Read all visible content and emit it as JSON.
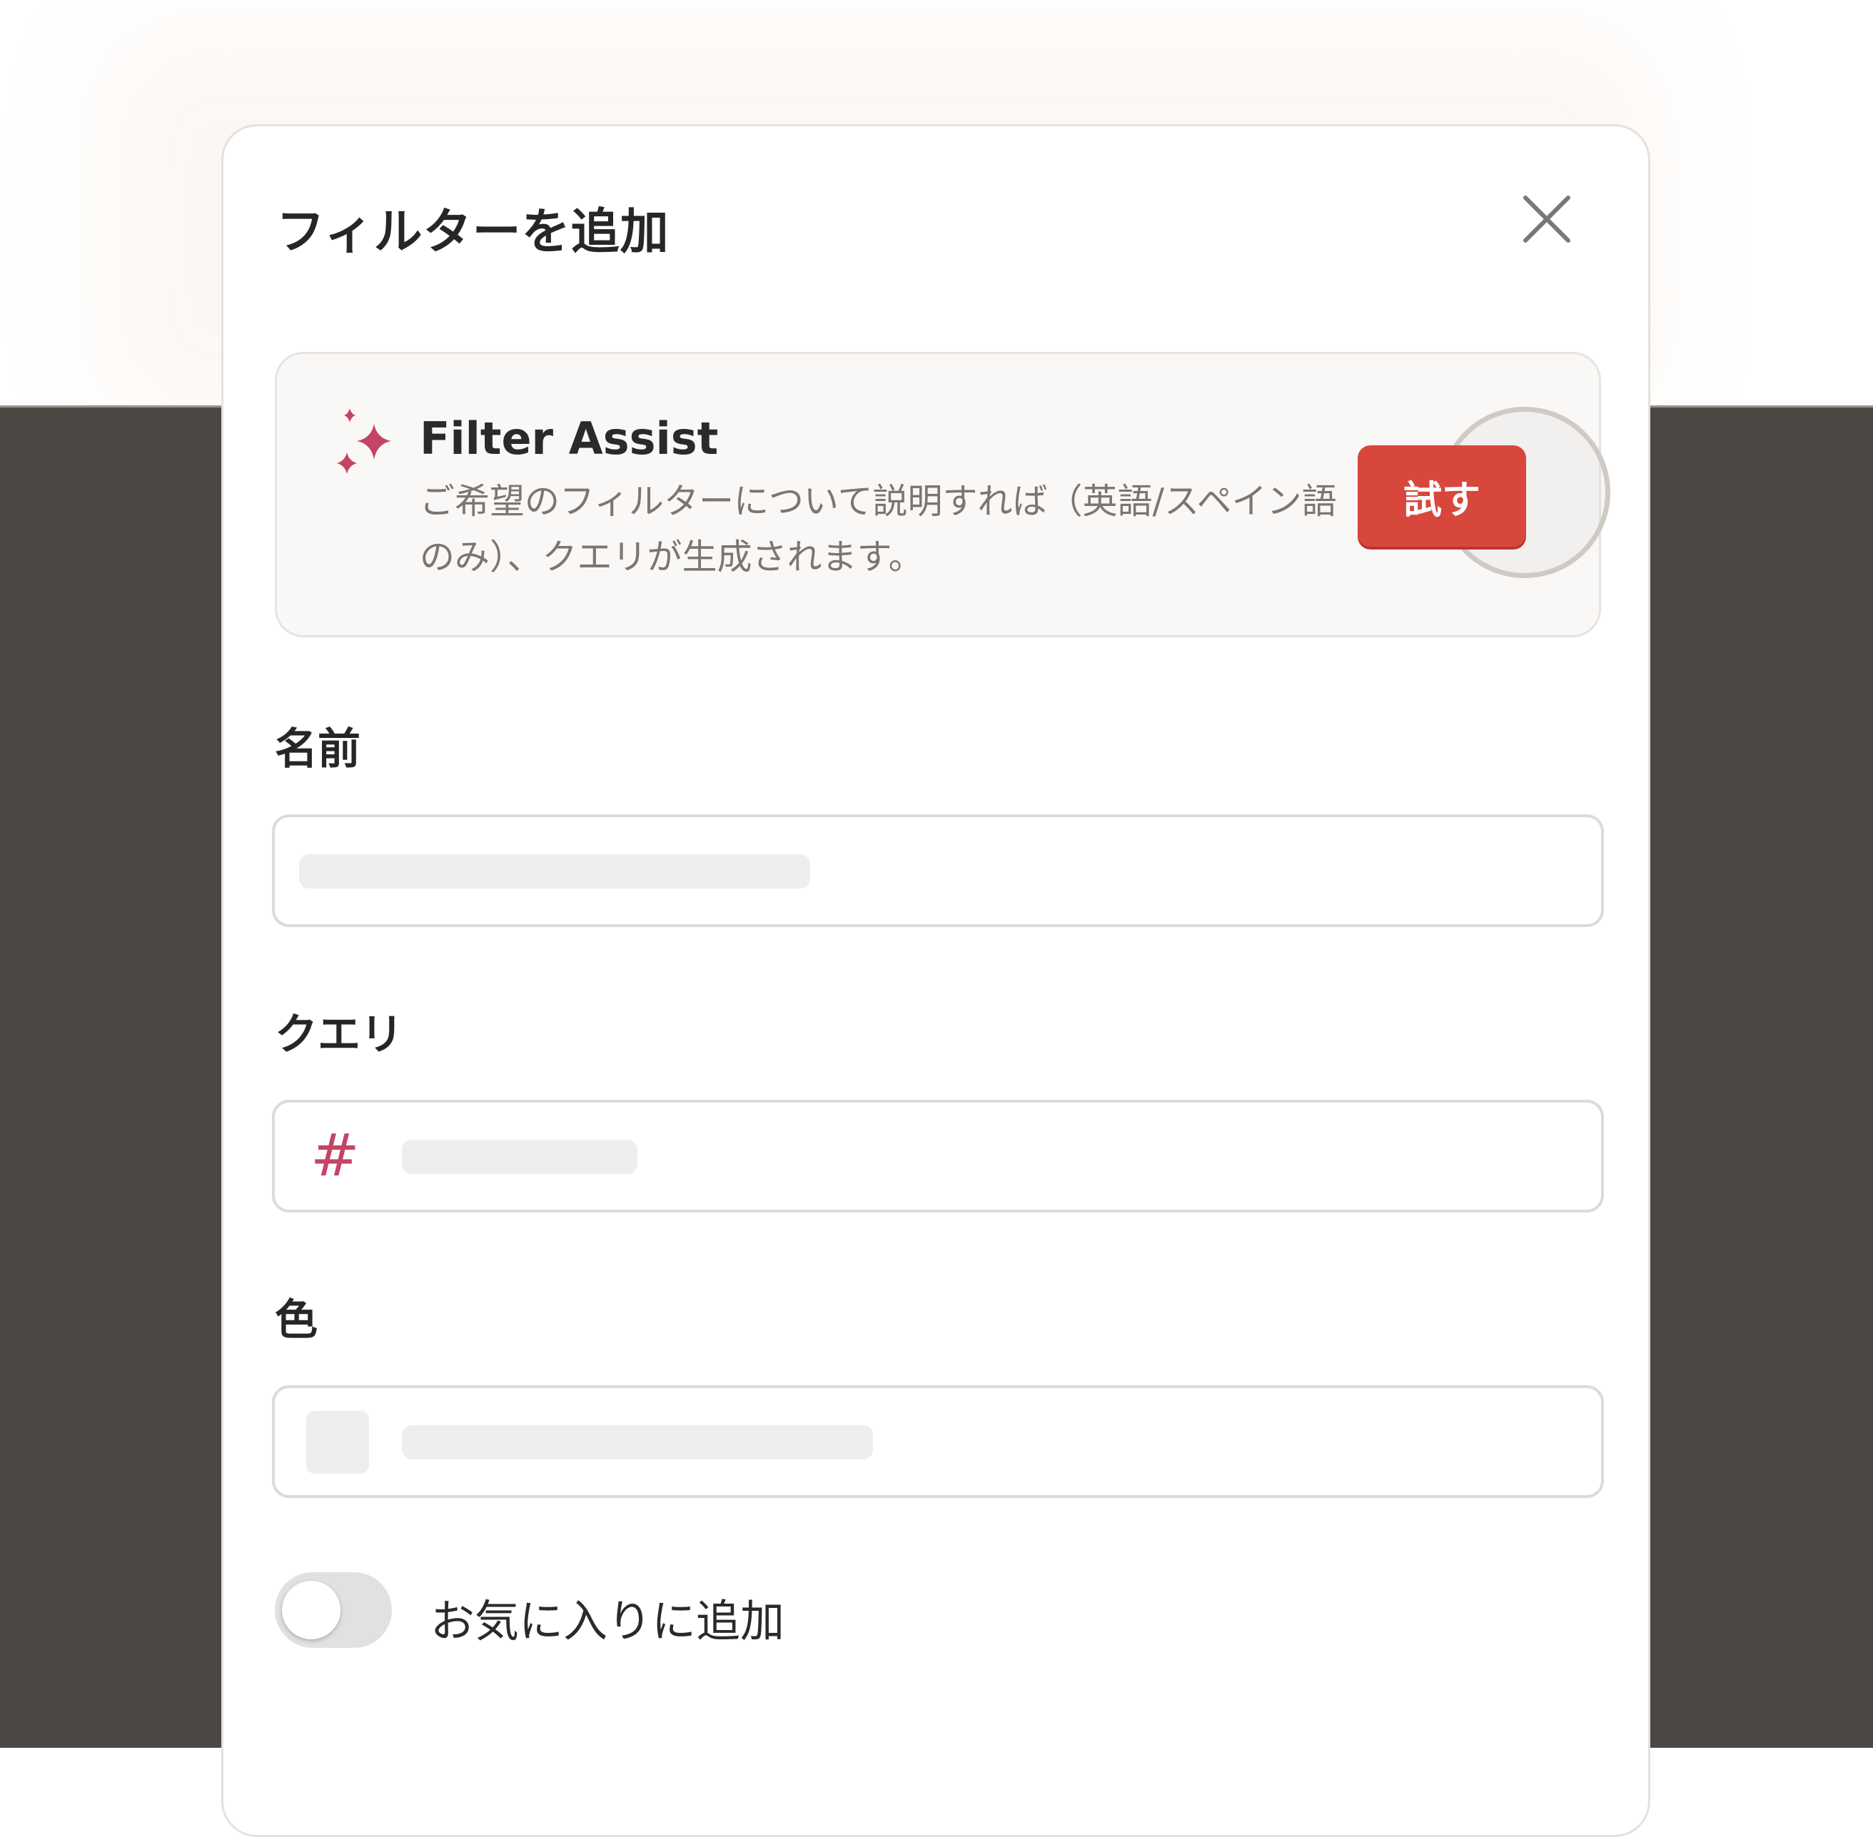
{
  "modal": {
    "title": "フィルターを追加",
    "close_icon": "close-icon"
  },
  "filter_assist": {
    "icon": "sparkle-icon",
    "title": "Filter Assist",
    "description": "ご希望のフィルターについて説明すれば（英語/スペイン語のみ）、クエリが生成されます。",
    "try_label": "試す"
  },
  "fields": {
    "name_label": "名前",
    "query_label": "クエリ",
    "query_icon": "#",
    "color_label": "色"
  },
  "favorite": {
    "label": "お気に入りに追加",
    "enabled": false
  },
  "colors": {
    "accent": "#d8473c",
    "hash": "#c44563",
    "backdrop": "#4b4844"
  }
}
